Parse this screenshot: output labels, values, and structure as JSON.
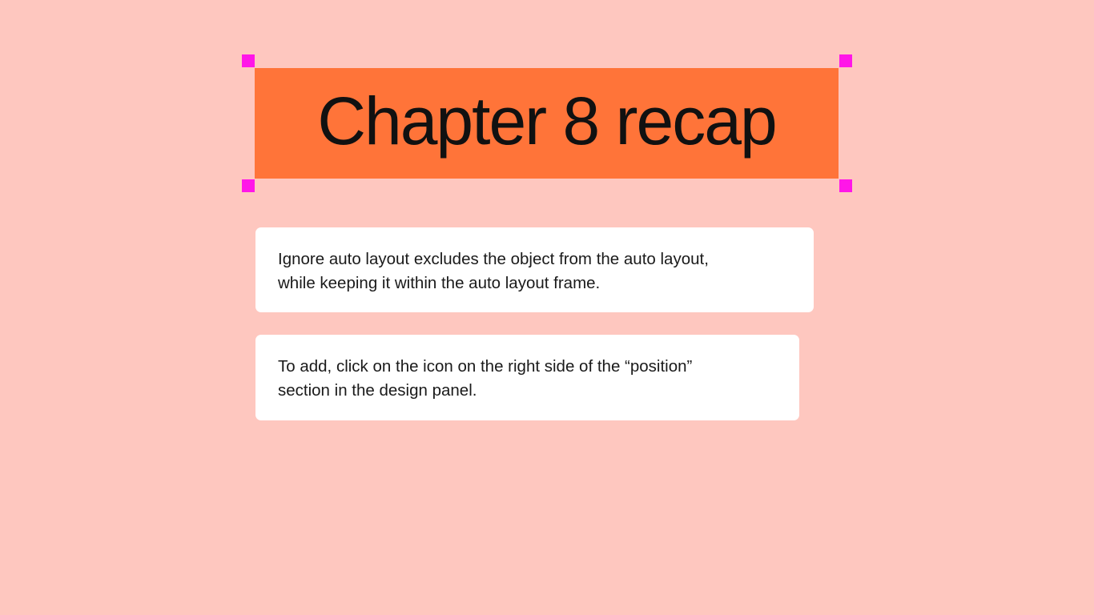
{
  "slide": {
    "title": "Chapter 8 recap",
    "cards": [
      {
        "text": "Ignore auto layout excludes the object from the auto layout,\nwhile keeping it within the auto layout frame."
      },
      {
        "text": "To add, click on the icon on the right side of the “position”\nsection in the design panel."
      }
    ]
  },
  "colors": {
    "background": "#fec7bf",
    "title_fill": "#ff7439",
    "selection_handle": "#ff16e8",
    "card_fill": "#ffffff",
    "text": "#111111"
  }
}
